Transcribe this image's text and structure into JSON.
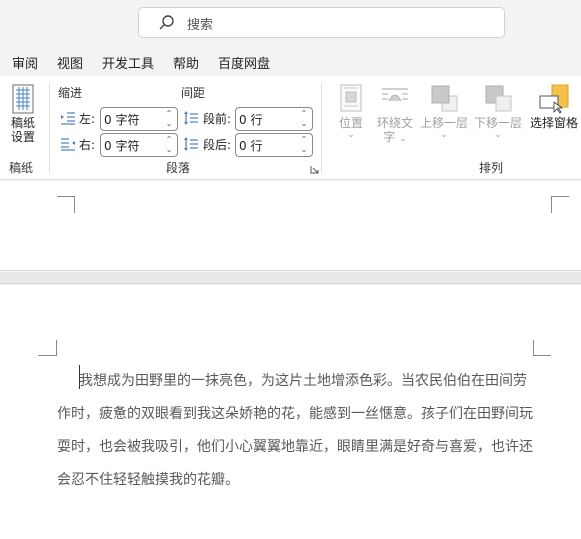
{
  "search": {
    "placeholder": "搜索"
  },
  "menu": [
    "审阅",
    "视图",
    "开发工具",
    "帮助",
    "百度网盘"
  ],
  "ribbon": {
    "draft": {
      "button": "稿纸\n设置",
      "group_label": "稿纸"
    },
    "paragraph": {
      "group_label": "段落",
      "indent_header": "缩进",
      "spacing_header": "间距",
      "left_label": "左:",
      "right_label": "右:",
      "before_label": "段前:",
      "after_label": "段后:",
      "left_value": "0 字符",
      "right_value": "0 字符",
      "before_value": "0 行",
      "after_value": "0 行"
    },
    "arrange": {
      "group_label": "排列",
      "position": "位置",
      "wrap_text_1": "环绕文",
      "wrap_text_2": "字",
      "bring_forward": "上移一层",
      "send_backward": "下移一层",
      "selection_pane": "选择窗格"
    }
  },
  "document": {
    "paragraph": "我想成为田野里的一抹亮色，为这片土地增添色彩。当农民伯伯在田间劳作时，疲惫的双眼看到我这朵娇艳的花，能感到一丝惬意。孩子们在田野间玩耍时，也会被我吸引，他们小心翼翼地靠近，眼睛里满是好奇与喜爱，也许还会忍不住轻轻触摸我的花瓣。"
  },
  "colors": {
    "accent": "#f5c14b",
    "text_gray": "#595959"
  }
}
